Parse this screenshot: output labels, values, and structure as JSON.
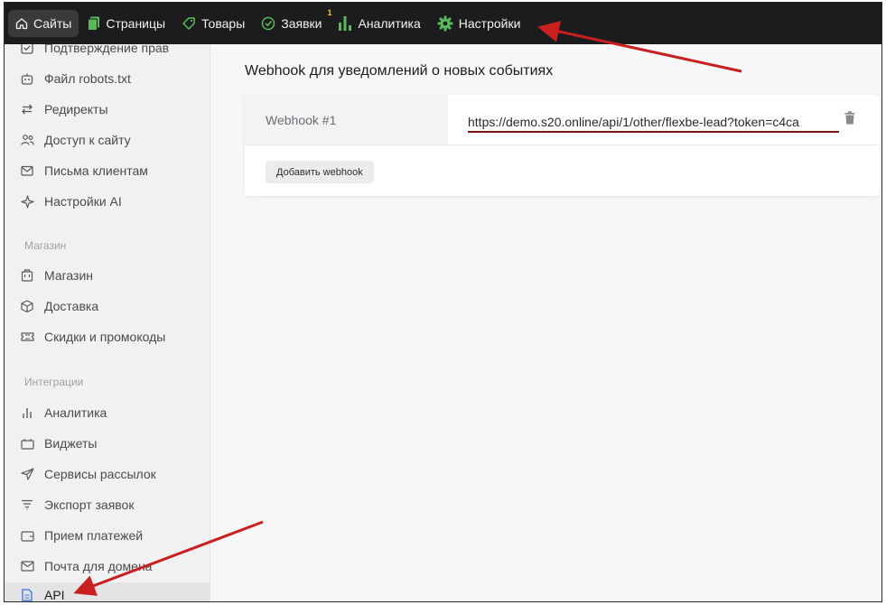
{
  "topbar": {
    "items": [
      {
        "label": "Сайты",
        "icon": "home-icon",
        "active": true
      },
      {
        "label": "Страницы",
        "icon": "pages-icon"
      },
      {
        "label": "Товары",
        "icon": "tag-icon"
      },
      {
        "label": "Заявки",
        "icon": "target-icon",
        "badge": "1"
      },
      {
        "label": "Аналитика",
        "icon": "bar-chart-icon"
      },
      {
        "label": "Настройки",
        "icon": "gear-icon"
      }
    ]
  },
  "sidebar": {
    "items": [
      {
        "label": "Подтверждение прав",
        "icon": "checkbox-icon"
      },
      {
        "label": "Файл robots.txt",
        "icon": "robot-icon"
      },
      {
        "label": "Редиректы",
        "icon": "redirect-icon"
      },
      {
        "label": "Доступ к сайту",
        "icon": "users-icon"
      },
      {
        "label": "Письма клиентам",
        "icon": "mail-check-icon"
      },
      {
        "label": "Настройки AI",
        "icon": "sparkle-icon"
      }
    ],
    "section_shop": "Магазин",
    "shop_items": [
      {
        "label": "Магазин",
        "icon": "shop-icon"
      },
      {
        "label": "Доставка",
        "icon": "box-icon"
      },
      {
        "label": "Скидки и промокоды",
        "icon": "ticket-icon"
      }
    ],
    "section_integrations": "Интеграции",
    "integration_items": [
      {
        "label": "Аналитика",
        "icon": "bars-icon"
      },
      {
        "label": "Виджеты",
        "icon": "widget-icon"
      },
      {
        "label": "Сервисы рассылок",
        "icon": "send-icon"
      },
      {
        "label": "Экспорт заявок",
        "icon": "filter-icon"
      },
      {
        "label": "Прием платежей",
        "icon": "wallet-icon"
      },
      {
        "label": "Почта для домена",
        "icon": "envelope-icon"
      },
      {
        "label": "API",
        "icon": "document-icon",
        "active": true
      }
    ]
  },
  "main": {
    "title": "Webhook для уведомлений о новых событиях",
    "webhook": {
      "label": "Webhook #1",
      "url": "https://demo.s20.online/api/1/other/flexbe-lead?token=c4ca"
    },
    "add_button": "Добавить webhook"
  },
  "colors": {
    "topbar_bg": "#1c1c1e",
    "accent_green": "#5cb85c",
    "annotation_red": "#c8201e",
    "underline": "#7a1414"
  }
}
